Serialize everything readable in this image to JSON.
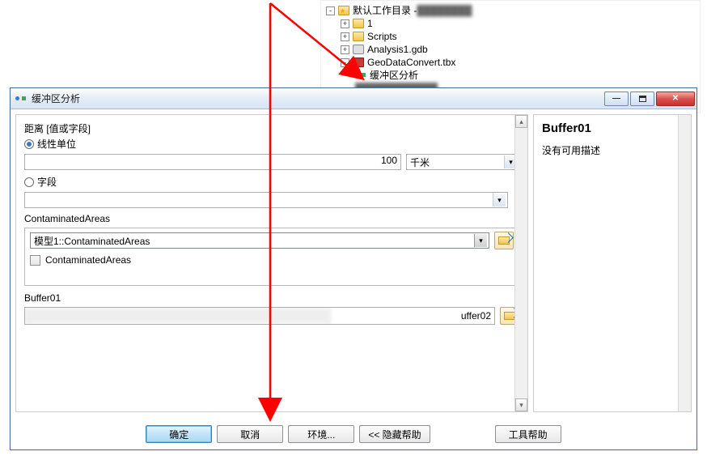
{
  "tree": {
    "root": {
      "toggle": "-",
      "label": "默认工作目录 -",
      "blur": true
    },
    "items": [
      {
        "toggle": "+",
        "icon": "folder",
        "label": "1"
      },
      {
        "toggle": "+",
        "icon": "folder",
        "label": "Scripts"
      },
      {
        "toggle": "+",
        "icon": "gdb",
        "label": "Analysis1.gdb"
      },
      {
        "toggle": "-",
        "icon": "tbx",
        "label": "GeoDataConvert.tbx"
      }
    ],
    "model": {
      "label": "缓冲区分析"
    }
  },
  "dialog": {
    "title": "缓冲区分析",
    "distance_group_label": "距离 [值或字段]",
    "radio_linear_label": "线性单位",
    "radio_field_label": "字段",
    "distance_value": "100",
    "unit_selected": "千米",
    "field_selected": "",
    "input_fc_label": "ContaminatedAreas",
    "input_fc_value": "模型1::ContaminatedAreas",
    "checkbox_label": "ContaminatedAreas",
    "output_label": "Buffer01",
    "output_tail": "uffer02",
    "help_title": "Buffer01",
    "help_body": "没有可用描述",
    "buttons": {
      "ok": "确定",
      "cancel": "取消",
      "env": "环境...",
      "hidehelp": "<< 隐藏帮助",
      "toolhelp": "工具帮助"
    }
  }
}
